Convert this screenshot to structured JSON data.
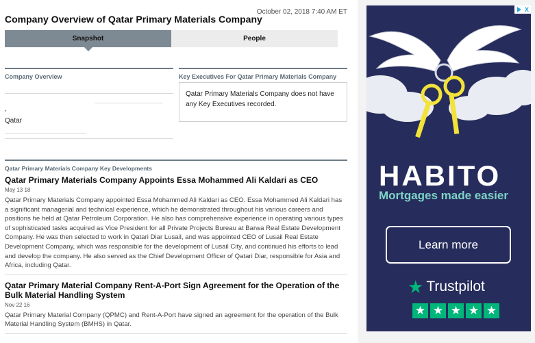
{
  "header": {
    "timestamp": "October 02, 2018 7:40 AM ET",
    "title": "Company Overview of Qatar Primary Materials Company"
  },
  "tabs": [
    {
      "label": "Snapshot",
      "active": true
    },
    {
      "label": "People",
      "active": false
    }
  ],
  "overview": {
    "heading": "Company Overview",
    "lines": [
      ",",
      "Qatar"
    ]
  },
  "executives": {
    "heading": "Key Executives For Qatar Primary Materials Company",
    "message": "Qatar Primary Materials Company does not have any Key Executives recorded."
  },
  "developments": {
    "heading": "Qatar Primary Materials Company Key Developments",
    "items": [
      {
        "title": "Qatar Primary Materials Company Appoints Essa Mohammed Ali Kaldari as CEO",
        "date": "May 13 18",
        "body": "Qatar Primary Materials Company appointed Essa Mohammed Ali Kaldari as CEO. Essa Mohammed Ali Kaldari has a significant managerial and technical experience, which he demonstrated throughout his various careers and positions he held at Qatar Petroleum Corporation. He also has comprehensive experience in operating various types of sophisticated tasks acquired as Vice President for all Private Projects Bureau at Barwa Real Estate Development Company. He was then selected to work in Qatari Diar Lusail, and was appointed CEO of Lusail Real Estate Development Company, which was responsible for the development of Lusail City, and continued his efforts to lead and develop the company. He also served as the Chief Development Officer of Qatari Diar, responsible for Asia and Africa, including Qatar."
      },
      {
        "title": "Qatar Primary Material Company Rent-A-Port Sign Agreement for the Operation of the Bulk Material Handling System",
        "date": "Nov 22 16",
        "body": "Qatar Primary Material Company (QPMC) and Rent-A-Port have signed an agreement for the operation of the Bulk Material Handling System (BMHS) in Qatar."
      }
    ]
  },
  "ad": {
    "adchoices_icon": "adchoices-icon",
    "close_label": "X",
    "brand": "HABITO",
    "tagline": "Mortgages made easier",
    "cta": "Learn more",
    "review_brand": "Trustpilot",
    "rating_stars": 5,
    "colors": {
      "background": "#262c5b",
      "accent": "#7dd3c7",
      "trustpilot": "#00b67a",
      "key": "#f2e23a"
    }
  }
}
